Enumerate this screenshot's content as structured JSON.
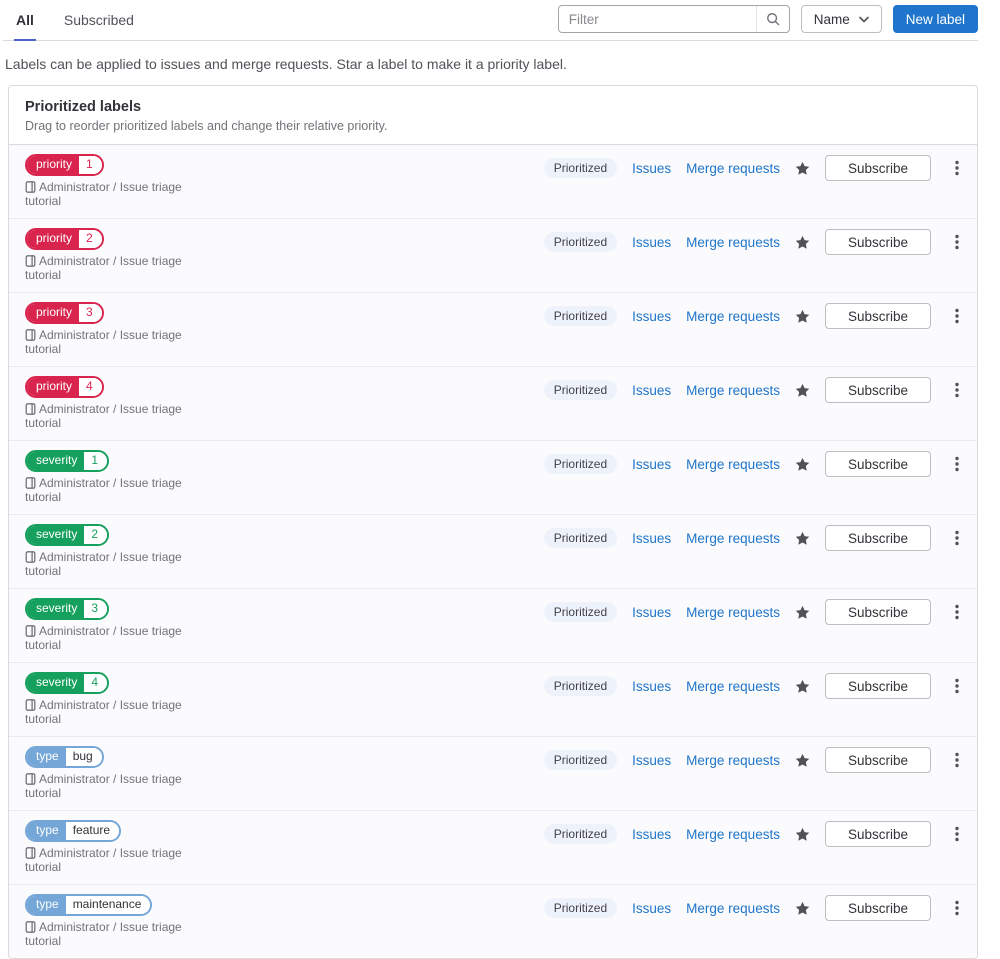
{
  "tabs": {
    "all": "All",
    "subscribed": "Subscribed"
  },
  "toolbar": {
    "filter_placeholder": "Filter",
    "sort_label": "Name",
    "new_label": "New label"
  },
  "description": "Labels can be applied to issues and merge requests. Star a label to make it a priority label.",
  "card": {
    "title": "Prioritized labels",
    "subtitle": "Drag to reorder prioritized labels and change their relative priority."
  },
  "row_shared": {
    "prioritized_badge": "Prioritized",
    "issues_link": "Issues",
    "merge_requests_link": "Merge requests",
    "subscribe_button": "Subscribe",
    "project_path": "Administrator / Issue triage tutorial"
  },
  "icons": {
    "search": "search-icon",
    "chevron_down": "chevron-down-icon",
    "star": "star-filled-icon",
    "kebab": "vertical-ellipsis-icon",
    "project": "project-icon"
  },
  "colors": {
    "link_blue": "#1f75cb",
    "primary_button_blue": "#1f75cb",
    "active_tab_underline": "#4e63ce",
    "priority_red": "#d9254e",
    "severity_green": "#16a05d",
    "type_blue": "#74a6d7",
    "badge_bg": "#eef3fb",
    "star_gray": "#535158"
  },
  "labels": [
    {
      "scope": "priority",
      "value": "1",
      "color": "#d9254e",
      "value_color": "#d9254e"
    },
    {
      "scope": "priority",
      "value": "2",
      "color": "#d9254e",
      "value_color": "#d9254e"
    },
    {
      "scope": "priority",
      "value": "3",
      "color": "#d9254e",
      "value_color": "#d9254e"
    },
    {
      "scope": "priority",
      "value": "4",
      "color": "#d9254e",
      "value_color": "#d9254e"
    },
    {
      "scope": "severity",
      "value": "1",
      "color": "#16a05d",
      "value_color": "#16a05d"
    },
    {
      "scope": "severity",
      "value": "2",
      "color": "#16a05d",
      "value_color": "#16a05d"
    },
    {
      "scope": "severity",
      "value": "3",
      "color": "#16a05d",
      "value_color": "#16a05d"
    },
    {
      "scope": "severity",
      "value": "4",
      "color": "#16a05d",
      "value_color": "#16a05d"
    },
    {
      "scope": "type",
      "value": "bug",
      "color": "#74a6d7",
      "value_color": "#333238"
    },
    {
      "scope": "type",
      "value": "feature",
      "color": "#74a6d7",
      "value_color": "#333238"
    },
    {
      "scope": "type",
      "value": "maintenance",
      "color": "#74a6d7",
      "value_color": "#333238"
    }
  ]
}
